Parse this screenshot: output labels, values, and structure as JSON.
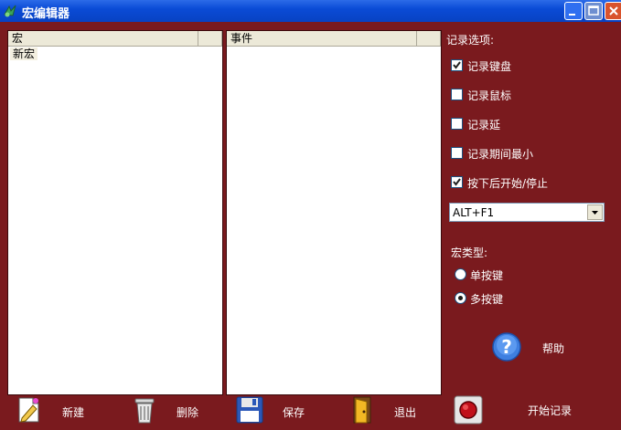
{
  "window": {
    "title": "宏编辑器"
  },
  "macro_list": {
    "header": "宏",
    "items": [
      "新宏"
    ]
  },
  "event_list": {
    "header": "事件"
  },
  "options": {
    "section_label": "记录选项:",
    "record_keyboard": {
      "label": "记录键盘",
      "checked": true
    },
    "record_mouse": {
      "label": "记录鼠标",
      "checked": false
    },
    "record_delay": {
      "label": "记录延",
      "checked": false
    },
    "minimize_during": {
      "label": "记录期间最小",
      "checked": false
    },
    "hotkey_start_stop": {
      "label": "按下后开始/停止",
      "checked": true
    },
    "hotkey_value": "ALT+F1"
  },
  "macro_type": {
    "label": "宏类型:",
    "single_key": {
      "label": "单按键",
      "selected": false
    },
    "multi_key": {
      "label": "多按键",
      "selected": true
    }
  },
  "help": {
    "label": "帮助"
  },
  "toolbar": {
    "new_label": "新建",
    "delete_label": "删除",
    "save_label": "保存",
    "exit_label": "退出",
    "start_record_label": "开始记录"
  }
}
